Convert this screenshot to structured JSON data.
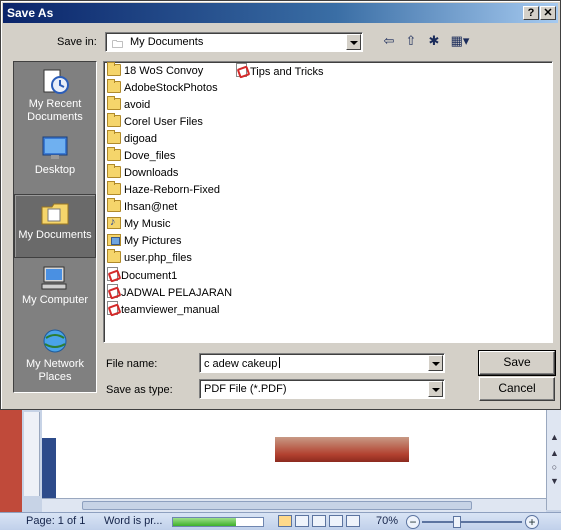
{
  "dialog": {
    "title": "Save As",
    "help_glyph": "?",
    "close_glyph": "✕",
    "save_in_label": "Save in:",
    "save_in_value": "My Documents",
    "file_name_label": "File name:",
    "file_name_value": "c adew cakeup",
    "save_as_type_label": "Save as type:",
    "save_as_type_value": "PDF File (*.PDF)",
    "save_button": "Save",
    "cancel_button": "Cancel",
    "toolbar_icons": [
      "back-icon",
      "up-folder-icon",
      "new-folder-icon",
      "views-icon"
    ]
  },
  "places": [
    {
      "label": "My Recent Documents",
      "icon": "recent-documents-icon",
      "selected": false
    },
    {
      "label": "Desktop",
      "icon": "desktop-icon",
      "selected": false
    },
    {
      "label": "My Documents",
      "icon": "my-documents-icon",
      "selected": true
    },
    {
      "label": "My Computer",
      "icon": "my-computer-icon",
      "selected": false
    },
    {
      "label": "My Network Places",
      "icon": "network-places-icon",
      "selected": false
    }
  ],
  "files_col1": [
    {
      "name": "18 WoS Convoy",
      "type": "folder"
    },
    {
      "name": "AdobeStockPhotos",
      "type": "folder"
    },
    {
      "name": "avoid",
      "type": "folder"
    },
    {
      "name": "Corel User Files",
      "type": "folder"
    },
    {
      "name": "digoad",
      "type": "folder"
    },
    {
      "name": "Dove_files",
      "type": "folder"
    },
    {
      "name": "Downloads",
      "type": "folder"
    },
    {
      "name": "Haze-Reborn-Fixed",
      "type": "folder"
    },
    {
      "name": "Ihsan@net",
      "type": "folder"
    },
    {
      "name": "My Music",
      "type": "music"
    },
    {
      "name": "My Pictures",
      "type": "pictures"
    },
    {
      "name": "user.php_files",
      "type": "folder"
    },
    {
      "name": "Document1",
      "type": "pdf"
    },
    {
      "name": "JADWAL PELAJARAN",
      "type": "pdf"
    },
    {
      "name": "teamviewer_manual",
      "type": "pdf"
    }
  ],
  "files_col2": [
    {
      "name": "Tips and Tricks",
      "type": "pdf"
    }
  ],
  "statusbar": {
    "page": "Page: 1 of 1",
    "status_text": "Word is pr...",
    "progress": 0.7,
    "zoom": "70%",
    "zoom_minus": "−",
    "zoom_plus": "+"
  }
}
